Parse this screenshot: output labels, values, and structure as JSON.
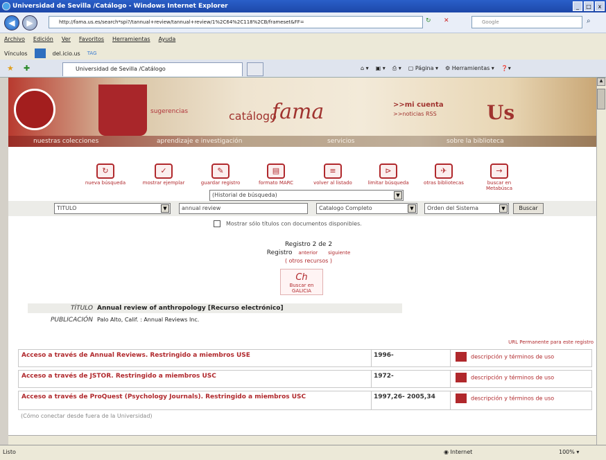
{
  "window": {
    "title": "Universidad de Sevilla /Catálogo - Windows Internet Explorer",
    "controls": [
      "_",
      "□",
      "x"
    ]
  },
  "address": {
    "url": "http://fama.us.es/search*spi?/tannual+review/tannual+review/1%2C64%2C118%2CB/frameset&FF=",
    "search_placeholder": "Google"
  },
  "menu": [
    "Archivo",
    "Edición",
    "Ver",
    "Favoritos",
    "Herramientas",
    "Ayuda"
  ],
  "links": {
    "label": "Vínculos",
    "item1": "del.icio.us",
    "item2": "TAG"
  },
  "tab": {
    "title": "Universidad de Sevilla /Catálogo"
  },
  "command_bar": {
    "page": "Página",
    "tools": "Herramientas"
  },
  "banner": {
    "sugerencias": "sugerencias",
    "catalogo": "catálogo",
    "fama": "fama",
    "mi_cuenta": ">>mi cuenta",
    "noticias": ">>noticias RSS",
    "logo_text": "Us"
  },
  "nav": [
    "nuestras colecciones",
    "aprendizaje e investigación",
    "servicios",
    "sobre la biblioteca"
  ],
  "toolbar": [
    {
      "label": "nueva búsqueda",
      "icon": "↻"
    },
    {
      "label": "mostrar ejemplar",
      "icon": "✓"
    },
    {
      "label": "guardar registro",
      "icon": "✎"
    },
    {
      "label": "formato MARC",
      "icon": "▤"
    },
    {
      "label": "volver al listado",
      "icon": "≡"
    },
    {
      "label": "limitar búsqueda",
      "icon": "⊳"
    },
    {
      "label": "otras bibliotecas",
      "icon": "✈"
    },
    {
      "label": "buscar en Metabúsca",
      "icon": "→"
    }
  ],
  "search": {
    "historial": "(Historial de búsqueda)",
    "field": "TITULO",
    "term": "annual review",
    "scope": "Catalogo Completo",
    "order": "Orden del Sistema",
    "button": "Buscar",
    "checkbox_label": "Mostrar sólo títulos con documentos disponibles."
  },
  "record": {
    "counter": "Registro 2 de 2",
    "registro": "Registro",
    "anterior": "anterior",
    "siguiente": "siguiente",
    "otros": "( otros recursos )",
    "galicia": "Buscar en GALICIA"
  },
  "fields": [
    {
      "label": "TÍTULO",
      "value": "Annual review of anthropology [Recurso electrónico]"
    },
    {
      "label": "PUBLICACIÓN",
      "value": "Palo Alto, Calif. : Annual Reviews Inc."
    }
  ],
  "permalink": "URL Permanente para este registro",
  "access": [
    {
      "source": "Acceso a través de Annual Reviews. Restringido a miembros USE",
      "years": "1996-",
      "desc": "descripción y términos de uso"
    },
    {
      "source": "Acceso a través de JSTOR. Restringido a miembros USC",
      "years": "1972-",
      "desc": "descripción y términos de uso"
    },
    {
      "source": "Acceso a través de ProQuest (Psychology Journals). Restringido a miembros USC",
      "years": "1997,26- 2005,34",
      "desc": "descripción y términos de uso"
    }
  ],
  "remote": "(Cómo conectar desde fuera de la Universidad)",
  "status": {
    "left": "Listo",
    "zone": "Internet",
    "zoom": "100%"
  }
}
